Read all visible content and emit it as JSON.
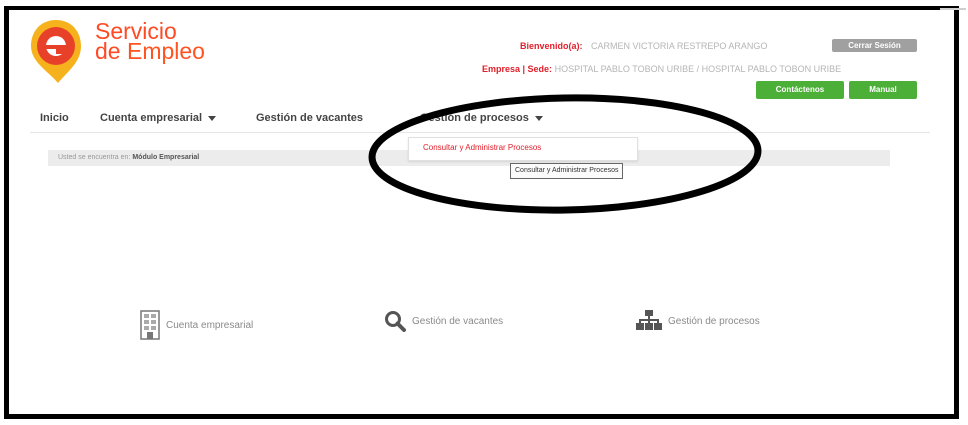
{
  "header": {
    "logo_line1": "Servicio",
    "logo_line2a": "de ",
    "logo_line2b": "Empleo",
    "welcome_label": "Bienvenido(a):",
    "user_name": "CARMEN VICTORIA RESTREPO ARANGO",
    "close_session_label": "Cerrar Sesión",
    "company_label": "Empresa | Sede:",
    "company_value": "HOSPITAL PABLO TOBON URIBE / HOSPITAL PABLO TOBON URIBE",
    "contact_label": "Contáctenos",
    "manual_label": "Manual",
    "accent_red": "#e0202b",
    "accent_orange": "#ff5422",
    "button_green": "#4caf38"
  },
  "nav": {
    "items": [
      {
        "label": "Inicio"
      },
      {
        "label": "Cuenta empresarial"
      },
      {
        "label": "Gestión de vacantes"
      },
      {
        "label": "Gestión de procesos"
      }
    ]
  },
  "breadcrumb": {
    "prefix": "Usted se encuentra en:",
    "current": "Módulo Empresarial"
  },
  "dropdown": {
    "item_label": "Consultar y Administrar Procesos",
    "tooltip": "Consultar y Administrar Procesos"
  },
  "features": [
    {
      "label": "Cuenta empresarial",
      "icon": "building-icon"
    },
    {
      "label": "Gestión de vacantes",
      "icon": "search-icon"
    },
    {
      "label": "Gestión de procesos",
      "icon": "org-chart-icon"
    }
  ]
}
